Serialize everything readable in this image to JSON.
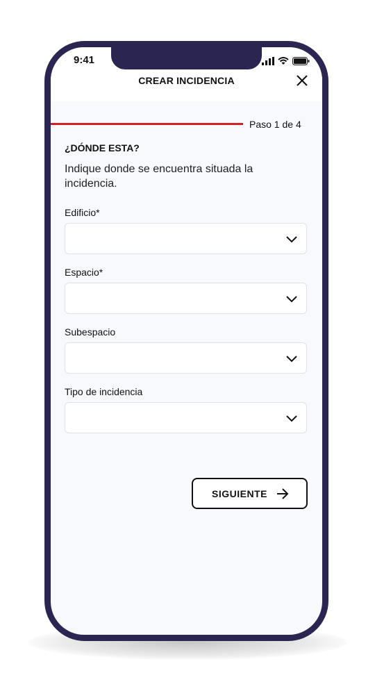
{
  "status_bar": {
    "time": "9:41"
  },
  "header": {
    "title": "CREAR INCIDENCIA",
    "close_icon": "close-icon"
  },
  "progress": {
    "step_text": "Paso 1 de 4",
    "fraction": 0.25,
    "color": "#d11f26"
  },
  "form": {
    "question": "¿DÓNDE ESTA?",
    "intro": "Indique donde se encuentra situada la incidencia.",
    "fields": [
      {
        "label": "Edificio*",
        "value": ""
      },
      {
        "label": "Espacio*",
        "value": ""
      },
      {
        "label": "Subespacio",
        "value": ""
      },
      {
        "label": "Tipo de incidencia",
        "value": ""
      }
    ]
  },
  "actions": {
    "next_label": "SIGUIENTE",
    "next_icon": "arrow-right-icon"
  },
  "colors": {
    "frame": "#2b2552",
    "accent": "#d11f26",
    "background": "#f8f9fc"
  }
}
